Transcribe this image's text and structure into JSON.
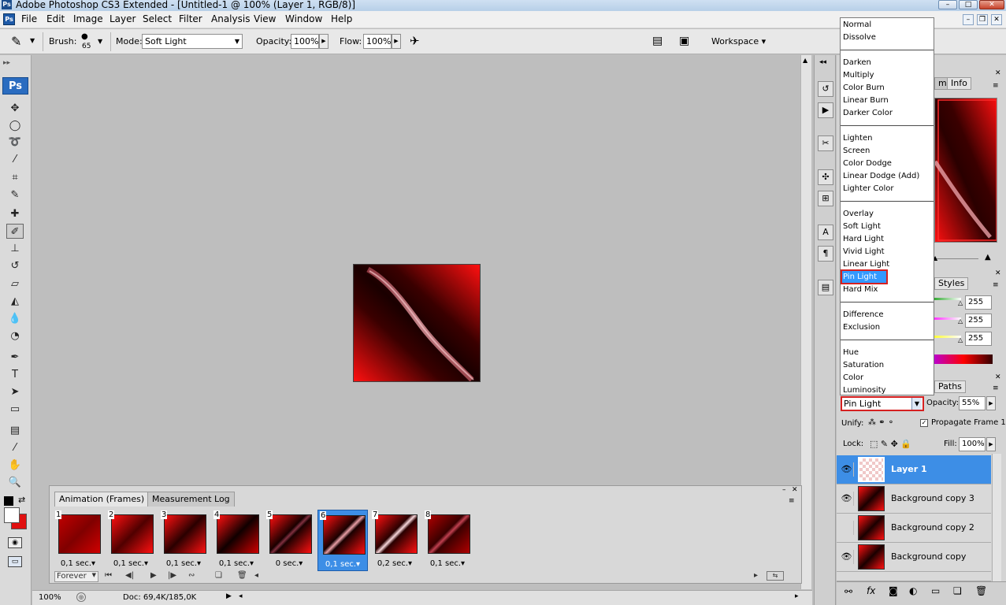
{
  "window": {
    "title": "Adobe Photoshop CS3 Extended - [Untitled-1 @ 100% (Layer 1, RGB/8)]",
    "min": "–",
    "max": "□",
    "close": "✕"
  },
  "menu": [
    "File",
    "Edit",
    "Image",
    "Layer",
    "Select",
    "Filter",
    "Analysis",
    "View",
    "Window",
    "Help"
  ],
  "options": {
    "brush_label": "Brush:",
    "brush_size": "65",
    "mode_label": "Mode:",
    "mode_value": "Soft Light",
    "opacity_label": "Opacity:",
    "opacity_value": "100%",
    "flow_label": "Flow:",
    "flow_value": "100%",
    "workspace_label": "Workspace ▾"
  },
  "toolbox": {
    "logo": "Ps",
    "tools": [
      {
        "name": "move-tool-icon",
        "glyph": "✥"
      },
      {
        "name": "marquee-tool-icon",
        "glyph": "◯"
      },
      {
        "name": "lasso-tool-icon",
        "glyph": "➰"
      },
      {
        "name": "magic-wand-tool-icon",
        "glyph": "⁄"
      },
      {
        "name": "crop-tool-icon",
        "glyph": "⌗"
      },
      {
        "name": "slice-tool-icon",
        "glyph": "✎"
      },
      {
        "name": "healing-brush-tool-icon",
        "glyph": "✚"
      },
      {
        "name": "brush-tool-icon",
        "glyph": "✐"
      },
      {
        "name": "clone-stamp-tool-icon",
        "glyph": "⊥"
      },
      {
        "name": "history-brush-tool-icon",
        "glyph": "↺"
      },
      {
        "name": "eraser-tool-icon",
        "glyph": "▱"
      },
      {
        "name": "paint-bucket-tool-icon",
        "glyph": "◭"
      },
      {
        "name": "blur-tool-icon",
        "glyph": "💧"
      },
      {
        "name": "dodge-tool-icon",
        "glyph": "◔"
      },
      {
        "name": "pen-tool-icon",
        "glyph": "✒"
      },
      {
        "name": "type-tool-icon",
        "glyph": "T"
      },
      {
        "name": "path-selection-tool-icon",
        "glyph": "➤"
      },
      {
        "name": "rectangle-tool-icon",
        "glyph": "▭"
      },
      {
        "name": "notes-tool-icon",
        "glyph": "▤"
      },
      {
        "name": "eyedropper-tool-icon",
        "glyph": "⁄"
      },
      {
        "name": "hand-tool-icon",
        "glyph": "✋"
      },
      {
        "name": "zoom-tool-icon",
        "glyph": "🔍"
      }
    ]
  },
  "animation": {
    "tabs": [
      "Animation (Frames)",
      "Measurement Log"
    ],
    "frames": [
      {
        "num": "1",
        "delay": "0,1 sec.",
        "selected": false
      },
      {
        "num": "2",
        "delay": "0,1 sec.",
        "selected": false
      },
      {
        "num": "3",
        "delay": "0,1 sec.",
        "selected": false
      },
      {
        "num": "4",
        "delay": "0,1 sec.",
        "selected": false
      },
      {
        "num": "5",
        "delay": "0 sec.",
        "selected": false
      },
      {
        "num": "6",
        "delay": "0,1 sec.",
        "selected": true
      },
      {
        "num": "7",
        "delay": "0,2 sec.",
        "selected": false
      },
      {
        "num": "8",
        "delay": "0,1 sec.",
        "selected": false
      }
    ],
    "loop": "Forever"
  },
  "status": {
    "zoom": "100%",
    "doc": "Doc: 69,4K/185,0K"
  },
  "panels": {
    "nav_tabs": [
      "m",
      "Info"
    ],
    "color_tab": "Styles",
    "color_values": [
      "255",
      "255",
      "255"
    ],
    "paths_tab": "Paths"
  },
  "layers": {
    "blend_mode": "Pin Light",
    "opacity_label": "Opacity:",
    "opacity_value": "55%",
    "unify_label": "Unify:",
    "propagate_label": "Propagate Frame 1",
    "lock_label": "Lock:",
    "fill_label": "Fill:",
    "fill_value": "100%",
    "items": [
      {
        "name": "Layer 1",
        "visible": true,
        "selected": true
      },
      {
        "name": "Background copy 3",
        "visible": true,
        "selected": false
      },
      {
        "name": "Background copy 2",
        "visible": false,
        "selected": false
      },
      {
        "name": "Background copy",
        "visible": true,
        "selected": false
      }
    ]
  },
  "blend_list": {
    "groups": [
      [
        "Normal",
        "Dissolve"
      ],
      [
        "Darken",
        "Multiply",
        "Color Burn",
        "Linear Burn",
        "Darker Color"
      ],
      [
        "Lighten",
        "Screen",
        "Color Dodge",
        "Linear Dodge (Add)",
        "Lighter Color"
      ],
      [
        "Overlay",
        "Soft Light",
        "Hard Light",
        "Vivid Light",
        "Linear Light",
        "Pin Light",
        "Hard Mix"
      ],
      [
        "Difference",
        "Exclusion"
      ],
      [
        "Hue",
        "Saturation",
        "Color",
        "Luminosity"
      ]
    ],
    "selected": "Pin Light"
  },
  "colors": {
    "accent_blue": "#3d8ee6",
    "highlight_red": "#d62020",
    "foreground": "#ffffff",
    "background": "#e01010"
  }
}
